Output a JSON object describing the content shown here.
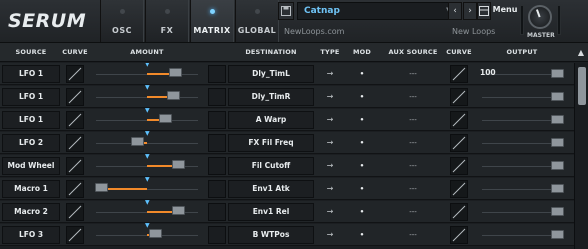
{
  "app": {
    "logo": "SERUM"
  },
  "tabs": [
    {
      "label": "OSC",
      "active": false
    },
    {
      "label": "FX",
      "active": false
    },
    {
      "label": "MATRIX",
      "active": true
    },
    {
      "label": "GLOBAL",
      "active": false
    }
  ],
  "preset": {
    "name": "Catnap",
    "author": "NewLoops.com",
    "bank": "New Loops",
    "menu_label": "Menu",
    "prev_icon": "‹",
    "next_icon": "›",
    "save_icon": "💾"
  },
  "master": {
    "label": "MASTER"
  },
  "headers": {
    "source": "SOURCE",
    "curve": "CURVE",
    "amount": "AMOUNT",
    "destination": "DESTINATION",
    "type": "TYPE",
    "mod": "MOD",
    "aux_source": "AUX SOURCE",
    "curve2": "CURVE",
    "output": "OUTPUT"
  },
  "rows": [
    {
      "source": "LFO 1",
      "amount": 0.55,
      "destination": "Dly_TimL",
      "type": "→",
      "mod": "•",
      "aux": "---",
      "output": "100"
    },
    {
      "source": "LFO 1",
      "amount": 0.5,
      "destination": "Dly_TimR",
      "type": "→",
      "mod": "•",
      "aux": "---",
      "output": ""
    },
    {
      "source": "LFO 1",
      "amount": 0.35,
      "destination": "A Warp",
      "type": "→",
      "mod": "•",
      "aux": "---",
      "output": ""
    },
    {
      "source": "LFO 2",
      "amount": -0.2,
      "destination": "FX Fil Freq",
      "type": "→",
      "mod": "•",
      "aux": "---",
      "output": ""
    },
    {
      "source": "Mod Wheel",
      "amount": 0.6,
      "destination": "Fil Cutoff",
      "type": "→",
      "mod": "•",
      "aux": "---",
      "output": ""
    },
    {
      "source": "Macro 1",
      "amount": -0.9,
      "destination": "Env1 Atk",
      "type": "→",
      "mod": "•",
      "aux": "---",
      "output": ""
    },
    {
      "source": "Macro 2",
      "amount": 0.6,
      "destination": "Env1 Rel",
      "type": "→",
      "mod": "•",
      "aux": "---",
      "output": ""
    },
    {
      "source": "LFO 3",
      "amount": 0.15,
      "destination": "B WTPos",
      "type": "→",
      "mod": "•",
      "aux": "---",
      "output": ""
    }
  ],
  "colors": {
    "accent": "#f28a2a",
    "highlight": "#5ec2ff",
    "preset_text": "#6fc3f5"
  }
}
